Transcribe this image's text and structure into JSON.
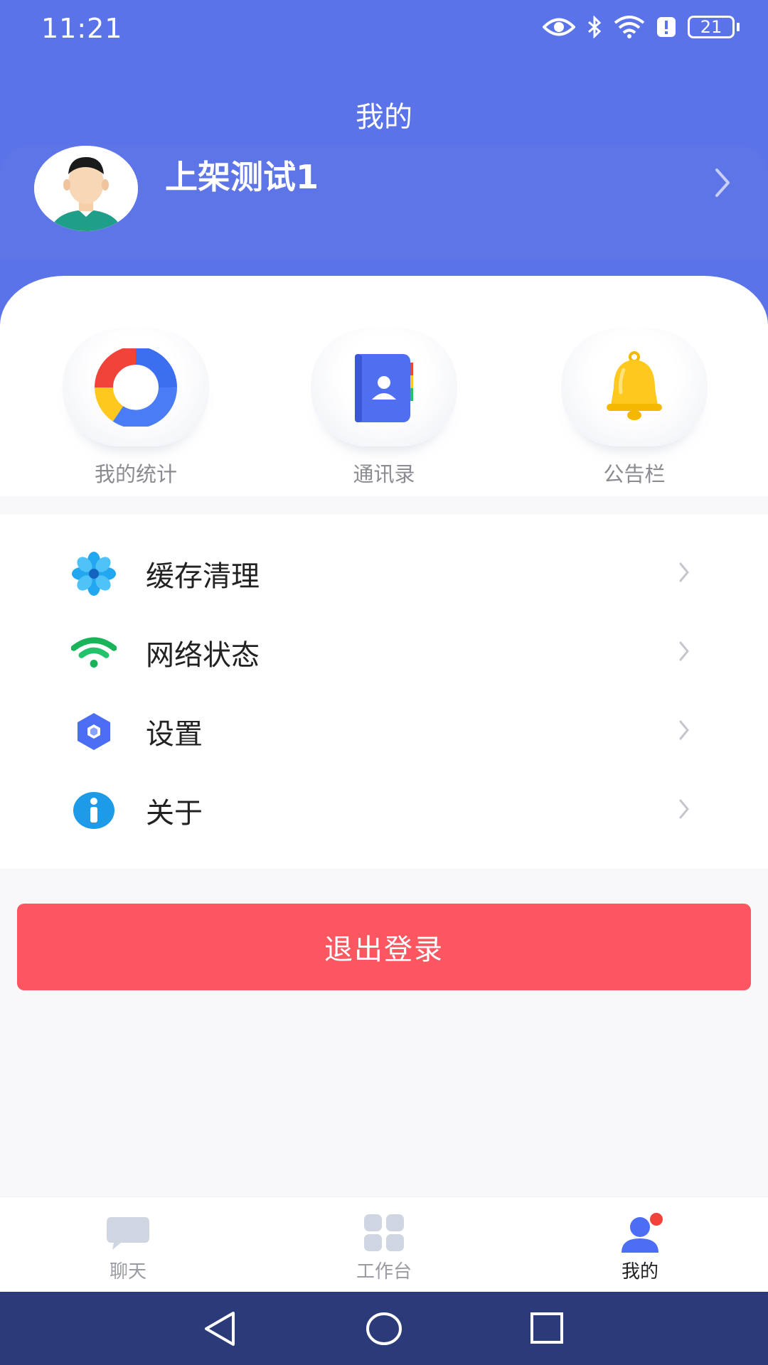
{
  "status_bar": {
    "time": "11:21",
    "battery": "21"
  },
  "header": {
    "title": "我的"
  },
  "profile": {
    "name": "上架测试1"
  },
  "quick_actions": [
    {
      "label": "我的统计",
      "icon": "statistics-ring-icon"
    },
    {
      "label": "通讯录",
      "icon": "contacts-book-icon"
    },
    {
      "label": "公告栏",
      "icon": "bell-icon"
    }
  ],
  "menu": [
    {
      "label": "缓存清理",
      "icon": "flower-icon"
    },
    {
      "label": "网络状态",
      "icon": "wifi-icon"
    },
    {
      "label": "设置",
      "icon": "hexagon-settings-icon"
    },
    {
      "label": "关于",
      "icon": "info-icon"
    }
  ],
  "logout": {
    "label": "退出登录"
  },
  "tabs": [
    {
      "label": "聊天",
      "icon": "chat-bubble-icon",
      "active": false
    },
    {
      "label": "工作台",
      "icon": "grid-icon",
      "active": false
    },
    {
      "label": "我的",
      "icon": "person-icon",
      "active": true
    }
  ],
  "colors": {
    "primary": "#5b73e8",
    "logout": "#fc5760",
    "navbar": "#2b3a78"
  }
}
